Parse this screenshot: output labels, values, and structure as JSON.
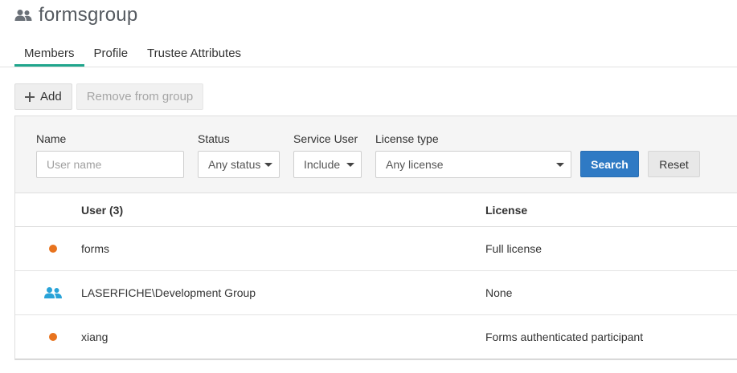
{
  "header": {
    "title": "formsgroup",
    "icon": "group-icon"
  },
  "tabs": [
    {
      "label": "Members",
      "active": true
    },
    {
      "label": "Profile",
      "active": false
    },
    {
      "label": "Trustee Attributes",
      "active": false
    }
  ],
  "toolbar": {
    "add_label": "Add",
    "remove_label": "Remove from group"
  },
  "filters": {
    "name_label": "Name",
    "name_placeholder": "User name",
    "status_label": "Status",
    "status_value": "Any status",
    "service_user_label": "Service User",
    "service_user_value": "Include",
    "license_type_label": "License type",
    "license_type_value": "Any license",
    "search_label": "Search",
    "reset_label": "Reset"
  },
  "table": {
    "columns": {
      "user": "User (3)",
      "license": "License"
    },
    "rows": [
      {
        "type": "user",
        "name": "forms",
        "license": "Full license",
        "status_color": "#e8731e"
      },
      {
        "type": "group",
        "name": "LASERFICHE\\Development Group",
        "license": "None",
        "status_color": "#29a3d8"
      },
      {
        "type": "user",
        "name": "xiang",
        "license": "Forms authenticated participant",
        "status_color": "#e8731e"
      }
    ]
  },
  "colors": {
    "accent": "#1fa58c",
    "primary_button": "#2f7ac4",
    "user_dot": "#e8731e",
    "group_icon": "#29a3d8"
  }
}
